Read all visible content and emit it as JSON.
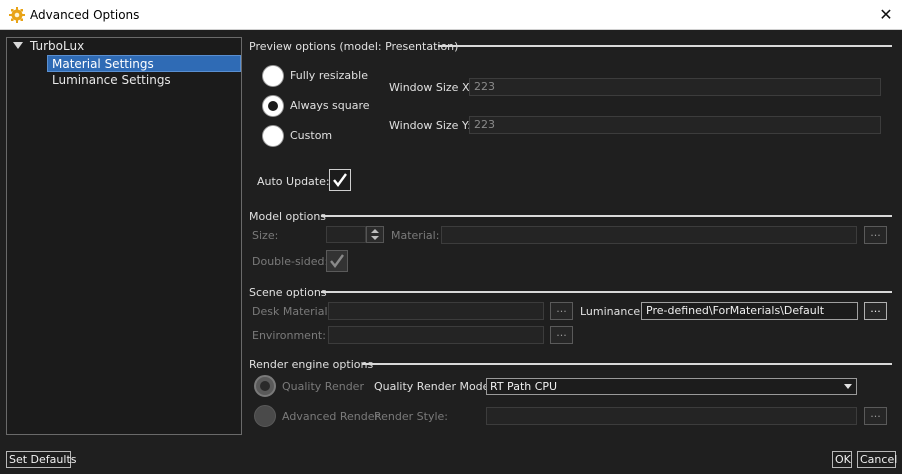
{
  "window": {
    "title": "Advanced Options",
    "close_glyph": "✕"
  },
  "tree": {
    "root": "TurboLux",
    "items": [
      {
        "label": "Material Settings",
        "selected": true
      },
      {
        "label": "Luminance Settings",
        "selected": false
      }
    ]
  },
  "preview": {
    "heading": "Preview options (model: Presentation)",
    "modes": [
      {
        "label": "Fully resizable",
        "checked": false
      },
      {
        "label": "Always square",
        "checked": true
      },
      {
        "label": "Custom",
        "checked": false
      }
    ],
    "window_size_x_label": "Window Size X:",
    "window_size_x_value": "223",
    "window_size_y_label": "Window Size Y:",
    "window_size_y_value": "223",
    "auto_update_label": "Auto Update:",
    "auto_update_checked": true
  },
  "model": {
    "heading": "Model options",
    "size_label": "Size:",
    "size_value": "",
    "material_label": "Material:",
    "material_value": "",
    "material_browse": "...",
    "double_sided_label": "Double-sided:",
    "double_sided_checked": true
  },
  "scene": {
    "heading": "Scene options",
    "desk_material_label": "Desk Material:",
    "desk_material_value": "",
    "desk_material_browse": "...",
    "luminance_label": "Luminance:",
    "luminance_value": "Pre-defined\\ForMaterials\\Default",
    "luminance_browse": "...",
    "environment_label": "Environment:",
    "environment_value": "",
    "environment_browse": "..."
  },
  "render": {
    "heading": "Render engine options",
    "quality_render_label": "Quality Render",
    "quality_render_checked": true,
    "quality_mode_label": "Quality Render Mode:",
    "quality_mode_value": "RT Path CPU",
    "advanced_render_label": "Advanced Render",
    "advanced_render_checked": false,
    "render_style_label": "Render Style:",
    "render_style_value": "",
    "render_style_browse": "..."
  },
  "footer": {
    "set_defaults": "Set Defaults",
    "ok": "OK",
    "cancel": "Cancel"
  },
  "colors": {
    "background": "#1f1f1f",
    "selection": "#2f6bb5",
    "title_icon": "#e8a317"
  },
  "icons": {
    "title": "gear-icon",
    "tree_expand": "triangle-down-icon",
    "checkmark": "checkmark-icon",
    "spinner": "spin-arrows-icon",
    "dropdown": "chevron-down-icon"
  }
}
